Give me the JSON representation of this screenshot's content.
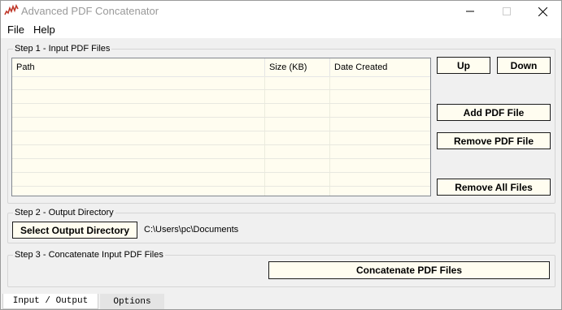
{
  "window": {
    "title": "Advanced PDF Concatenator",
    "controls": [
      "minimize",
      "maximize",
      "close"
    ]
  },
  "menu": {
    "items": [
      "File",
      "Help"
    ]
  },
  "step1": {
    "label": "Step 1 - Input PDF Files",
    "columns": [
      "Path",
      "Size (KB)",
      "Date Created"
    ],
    "rows": [],
    "buttons": {
      "up": "Up",
      "down": "Down",
      "add": "Add PDF File",
      "remove": "Remove PDF File",
      "remove_all": "Remove All Files"
    }
  },
  "step2": {
    "label": "Step 2 - Output Directory",
    "select_button": "Select Output Directory",
    "output_path": "C:\\Users\\pc\\Documents"
  },
  "step3": {
    "label": "Step 3 - Concatenate Input PDF Files",
    "concatenate_button": "Concatenate PDF Files"
  },
  "tabs": [
    {
      "label": "Input / Output",
      "active": true
    },
    {
      "label": "Options",
      "active": false
    }
  ],
  "colors": {
    "list_background": "#fffdf0",
    "button_background": "#fffdf0",
    "title_color": "#999999"
  }
}
